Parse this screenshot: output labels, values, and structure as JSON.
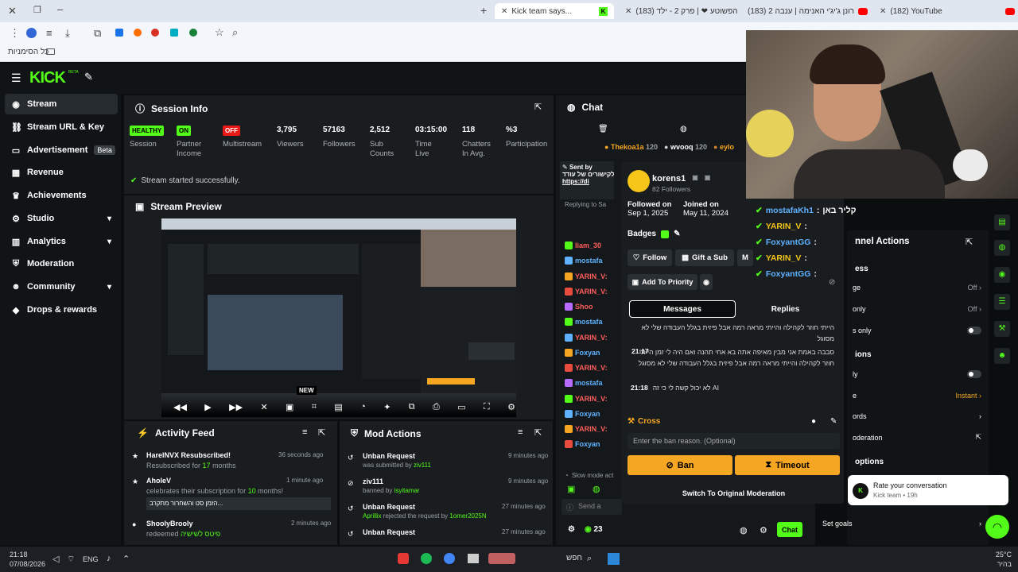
{
  "browser": {
    "tabs": [
      {
        "label": "Kick team says..."
      },
      {
        "label": "(183) הפשוטע ❤ | פרק 2 - ילד"
      },
      {
        "label": "(183) רונן ג'יג'י האנימה | ענבה 2"
      },
      {
        "label": "(182) YouTube"
      }
    ],
    "bookmarks_label": "כל הסימניות"
  },
  "kick": {
    "logo": "KICK",
    "beta": "BETA"
  },
  "sidebar": {
    "items": [
      {
        "label": "Stream"
      },
      {
        "label": "Stream URL & Key"
      },
      {
        "label": "Advertisement",
        "badge": "Beta"
      },
      {
        "label": "Revenue"
      },
      {
        "label": "Achievements"
      },
      {
        "label": "Studio"
      },
      {
        "label": "Analytics"
      },
      {
        "label": "Moderation"
      },
      {
        "label": "Community"
      },
      {
        "label": "Drops & rewards"
      }
    ]
  },
  "session": {
    "title": "Session Info",
    "stats": [
      {
        "value": "HEALTHY",
        "label": "Session"
      },
      {
        "value": "ON",
        "label": "Partner Income"
      },
      {
        "value": "OFF",
        "label": "Multistream"
      },
      {
        "value": "3,795",
        "label": "Viewers"
      },
      {
        "value": "57163",
        "label": "Followers"
      },
      {
        "value": "2,512",
        "label": "Sub Counts"
      },
      {
        "value": "03:15:00",
        "label": "Time Live"
      },
      {
        "value": "118",
        "label": "Chatters In Avg."
      },
      {
        "value": "%3",
        "label": "Participation"
      }
    ],
    "success": "Stream started successfully."
  },
  "preview": {
    "title": "Stream Preview",
    "new_label": "NEW"
  },
  "activity": {
    "title": "Activity Feed",
    "items": [
      {
        "name": "HarelNVX Resubscribed!",
        "detail_pre": "Resubscribed for ",
        "detail_num": "17",
        "detail_post": " months",
        "time": "36 seconds ago"
      },
      {
        "name": "AholeV",
        "detail_pre": "celebrates their subscription for ",
        "detail_num": "10",
        "detail_post": " months!",
        "quote": "הזמן סט והשחרור מתקרב...",
        "time": "1 minute ago"
      },
      {
        "name": "ShoolyBrooly",
        "detail_pre": "redeemed ",
        "detail_num": "פיטס לשישיה",
        "detail_post": "",
        "time": "2 minutes ago"
      }
    ]
  },
  "modactions": {
    "title": "Mod Actions",
    "items": [
      {
        "title": "Unban Request",
        "sub_pre": "was submitted by ",
        "sub_user": "ziv111",
        "time": "9 minutes ago"
      },
      {
        "title": "ziv111",
        "sub_pre": "banned by ",
        "sub_user": "isyitamar",
        "time": "9 minutes ago"
      },
      {
        "title": "Unban Request",
        "sub_user": "Aprillix",
        "sub_pre": " rejected the request by ",
        "sub_user2": "1omer2025N",
        "time": "27 minutes ago"
      },
      {
        "title": "Unban Request",
        "sub_pre": "",
        "sub_user": "",
        "time": "27 minutes ago"
      }
    ]
  },
  "chat": {
    "title": "Chat",
    "top_gifters": [
      {
        "name": "Thekoa1a",
        "count": "120"
      },
      {
        "name": "wvooq",
        "count": "120"
      },
      {
        "name": "eylo"
      }
    ],
    "pinned_title": "Sent by",
    "pinned_text": "ברוך הבא לקישורים של עודד",
    "pinned_link": "https://di",
    "replying": "Replying to Sa",
    "users": [
      "liam_30",
      "mostafa",
      "YARIN_V:",
      "YARIN_V:",
      "Shoo",
      "mostafa",
      "YARIN_V:",
      "Foxyan",
      "YARIN_V:",
      "mostafa",
      "YARIN_V:",
      "Foxyan",
      "YARIN_V:",
      "Foxyan"
    ],
    "slow_mode": "Slow mode act",
    "send_placeholder": "Send a",
    "count": "23",
    "chat_button": "Chat"
  },
  "usercard": {
    "name": "korens1",
    "followers": "82 Followers",
    "followed_on_label": "Followed on",
    "followed_on": "Sep 1, 2025",
    "joined_on_label": "Joined on",
    "joined_on": "May 11, 2024",
    "badges_label": "Badges",
    "follow": "Follow",
    "gift": "Gift a Sub",
    "more": "M",
    "priority": "Add To Priority",
    "tab_messages": "Messages",
    "tab_replies": "Replies",
    "messages": [
      {
        "time": "",
        "text": "הייתי חוזר לקהילה והייתי מראה רמה אבל פיזית בגלל העבודה שלי לא מסוגל"
      },
      {
        "time": "21:17",
        "text": "סבבה באמת אני מבין מאיפה אתה בא אחי תהנה ואם היה לי זמן הייתי חוזר לקהילה והייתי מראה רמה אבל פיזית בגלל העבודה שלי לא מסוגל"
      },
      {
        "time": "21:18",
        "text": "AI לא יכול קשה לי כי זה"
      }
    ],
    "cross_label": "Cross",
    "ban_placeholder": "Enter the ban reason. (Optional)",
    "ban": "Ban",
    "timeout": "Timeout",
    "switch": "Switch To Original Moderation"
  },
  "overlay_chat": [
    {
      "name": "mostafaKh1",
      "text": "קליר באן"
    },
    {
      "name": "YARIN_V",
      "text": ""
    },
    {
      "name": "FoxyantGG",
      "text": ""
    },
    {
      "name": "YARIN_V",
      "text": ""
    },
    {
      "name": "FoxyantGG",
      "text": ""
    }
  ],
  "channel_actions": {
    "title": "nnel Actions",
    "section1": "ess",
    "rows": [
      {
        "label": "ge",
        "value": "Off"
      },
      {
        "label": "only",
        "value": "Off"
      },
      {
        "label": "s only",
        "value": ""
      }
    ],
    "section2": "ions",
    "rows2": [
      {
        "label": "ly",
        "value": ""
      },
      {
        "label": "e",
        "value": "Instant"
      },
      {
        "label": "ords",
        "value": ""
      },
      {
        "label": "oderation",
        "value": ""
      }
    ],
    "section3": "options",
    "goals": "Set goals"
  },
  "toast": {
    "title": "Rate your conversation",
    "sub": "Kick team • 19h"
  },
  "taskbar": {
    "time": "21:18",
    "date": "07/08/2026",
    "lang": "ENG",
    "search": "חפש",
    "weather": "25°C",
    "weather_sub": "בהיר"
  }
}
